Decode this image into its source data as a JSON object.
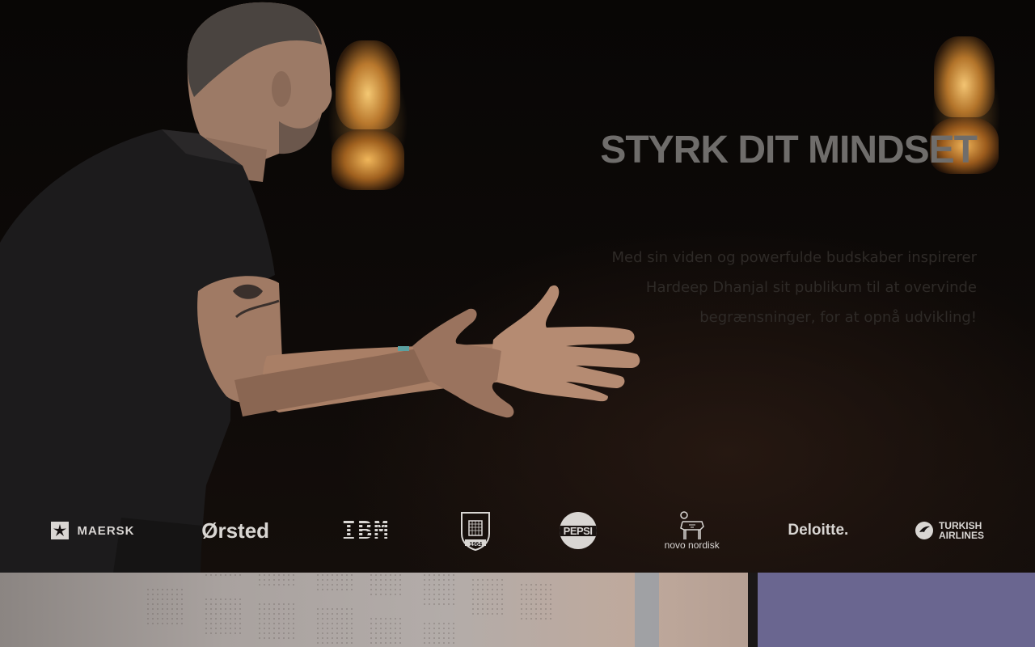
{
  "hero": {
    "title": "STYRK DIT MINDSET",
    "text_lines": [
      "Med sin viden og powerfulde budskaber inspirerer",
      "Hardeep Dhanjal sit publikum til at overvinde",
      "begrænsninger, for at opnå udvikling!"
    ]
  },
  "logos": {
    "maersk": "MAERSK",
    "orsted": "Ørsted",
    "ibm": "IBM",
    "brondby_year": "1964",
    "pepsi": "PEPSI",
    "novo": "novo nordisk",
    "deloitte": "Deloitte.",
    "turkish_1": "TURKISH",
    "turkish_2": "AIRLINES"
  },
  "colors": {
    "title": "#6f6d6b",
    "logo": "#d9d6d3"
  }
}
